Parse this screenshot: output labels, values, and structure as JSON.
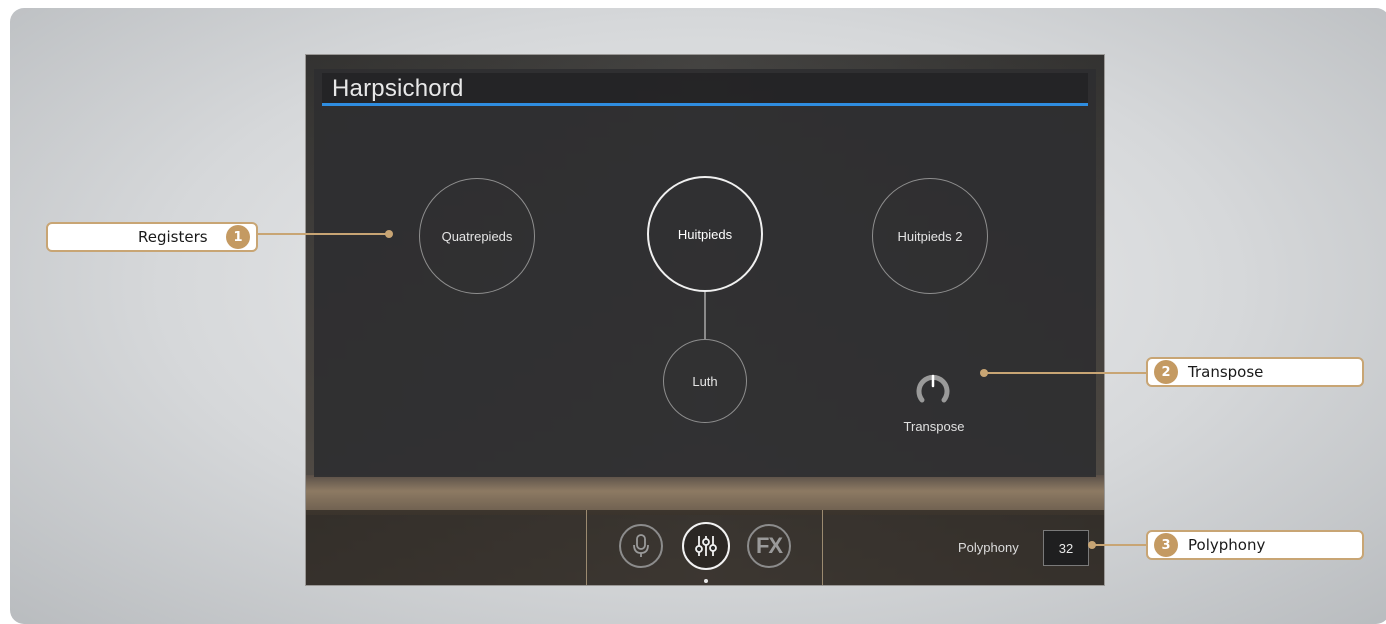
{
  "instrument": {
    "title": "Harpsichord",
    "registers": [
      {
        "label": "Quatrepieds",
        "active": false
      },
      {
        "label": "Huitpieds",
        "active": true
      },
      {
        "label": "Huitpieds 2",
        "active": false
      },
      {
        "label": "Luth",
        "active": false
      }
    ],
    "transpose": {
      "label": "Transpose"
    },
    "tabs": [
      {
        "name": "mic-icon"
      },
      {
        "name": "mixer-sliders-icon",
        "active": true
      },
      {
        "name": "fx-icon",
        "label": "FX"
      }
    ],
    "polyphony": {
      "label": "Polyphony",
      "value": "32"
    }
  },
  "callouts": [
    {
      "number": "1",
      "label": "Registers"
    },
    {
      "number": "2",
      "label": "Transpose"
    },
    {
      "number": "3",
      "label": "Polyphony"
    }
  ],
  "colors": {
    "accent_blue": "#2f8de0",
    "callout_gold": "#c8a574",
    "panel_dark": "#2e2e30"
  }
}
